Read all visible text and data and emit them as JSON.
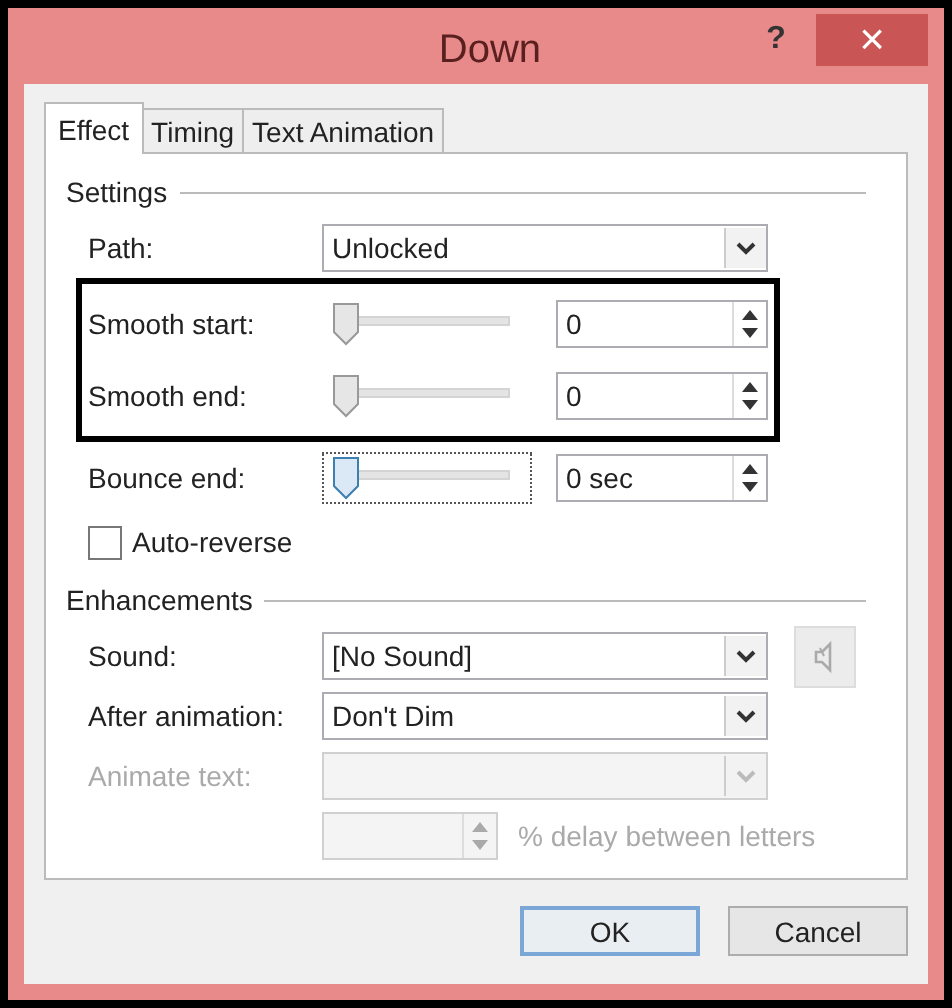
{
  "window": {
    "title": "Down",
    "help": "?",
    "close": "×"
  },
  "tabs": [
    {
      "label": "Effect",
      "selected": true
    },
    {
      "label": "Timing",
      "selected": false
    },
    {
      "label": "Text Animation",
      "selected": false
    }
  ],
  "settings": {
    "heading": "Settings",
    "path": {
      "label": "Path:",
      "value": "Unlocked"
    },
    "annotated_sliders": [
      {
        "label": "Smooth start:",
        "level": 0,
        "value": "0",
        "focused": false
      },
      {
        "label": "Smooth end:",
        "level": 0,
        "value": "0",
        "focused": false
      }
    ],
    "sliders": [
      {
        "label": "Bounce end:",
        "level": 0,
        "value": "0 sec",
        "focused": true
      }
    ],
    "auto_reverse": {
      "label": "Auto-reverse",
      "checked": false
    }
  },
  "enhancements": {
    "heading": "Enhancements",
    "dropdowns": [
      {
        "label": "Sound:",
        "value": "[No Sound]",
        "disabled": false,
        "speaker": true
      },
      {
        "label": "After animation:",
        "value": "Don't Dim",
        "disabled": false,
        "speaker": false
      },
      {
        "label": "Animate text:",
        "disabled": true,
        "speaker": false
      }
    ],
    "delay": {
      "label": "% delay between letters",
      "disabled": true
    }
  },
  "buttons": [
    {
      "label": "OK",
      "default": true
    },
    {
      "label": "Cancel",
      "default": false
    }
  ]
}
